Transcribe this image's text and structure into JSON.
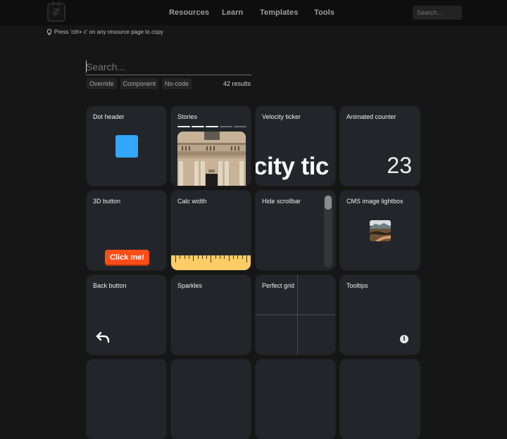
{
  "header": {
    "logo": "calendar-logo-icon",
    "nav": [
      "Resources",
      "Learn",
      "Templates",
      "Tools"
    ],
    "search_placeholder": "Search..."
  },
  "hint": {
    "icon": "lightbulb-icon",
    "text": "Press 'ctrl+ c' on any resource page to copy"
  },
  "search": {
    "placeholder": "Search...",
    "value": "",
    "filters": [
      "Override",
      "Component",
      "No-code"
    ],
    "results": "42 results"
  },
  "colors": {
    "accent_blue": "#33a6ff",
    "button_orange": "#ff4d18",
    "ruler_yellow": "#ffcc66",
    "card_bg": "#22262a"
  },
  "cards": [
    {
      "title": "Dot header"
    },
    {
      "title": "Stories",
      "progress_segments_done": 3,
      "progress_segments_total": 5
    },
    {
      "title": "Velocity ticker",
      "preview_text": "city tic"
    },
    {
      "title": "Animated counter",
      "value": "23"
    },
    {
      "title": "3D button",
      "button_label": "Click me!"
    },
    {
      "title": "Calc width"
    },
    {
      "title": "Hide scrollbar"
    },
    {
      "title": "CMS image lightbox"
    },
    {
      "title": "Back button"
    },
    {
      "title": "Sparkles"
    },
    {
      "title": "Perfect grid"
    },
    {
      "title": "Tooltips",
      "icon": "info-icon"
    }
  ]
}
